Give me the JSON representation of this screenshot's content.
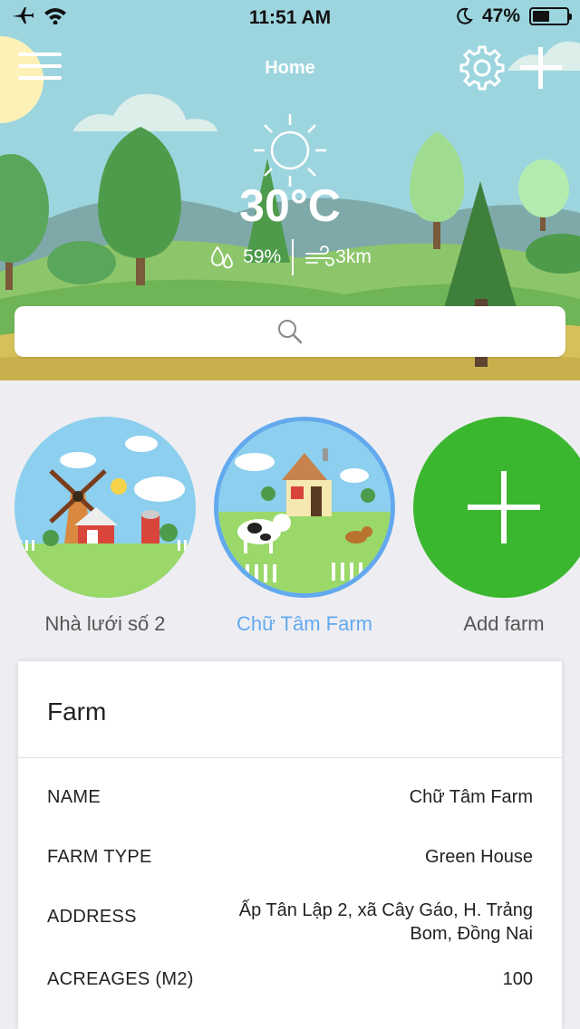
{
  "status_bar": {
    "time": "11:51 AM",
    "battery": "47%"
  },
  "header": {
    "title": "Home"
  },
  "weather": {
    "temperature": "30°C",
    "humidity": "59%",
    "wind": "3km"
  },
  "search": {
    "placeholder": ""
  },
  "farms": [
    {
      "name": "Nhà lưới số 2",
      "active": false
    },
    {
      "name": "Chữ Tâm Farm",
      "active": true
    },
    {
      "name": "Add farm",
      "active": false
    }
  ],
  "farm_card": {
    "title": "Farm",
    "rows": [
      {
        "label": "NAME",
        "value": "Chữ Tâm Farm"
      },
      {
        "label": "FARM TYPE",
        "value": "Green House"
      },
      {
        "label": "ADDRESS",
        "value": "Ấp Tân Lập 2, xã Cây Gáo, H. Trảng Bom, Đồng Nai"
      },
      {
        "label": "ACREAGES (M2)",
        "value": "100"
      }
    ]
  },
  "colors": {
    "accent": "#62a9ee",
    "add_green": "#3bb72f",
    "sky": "#9dd5df"
  }
}
